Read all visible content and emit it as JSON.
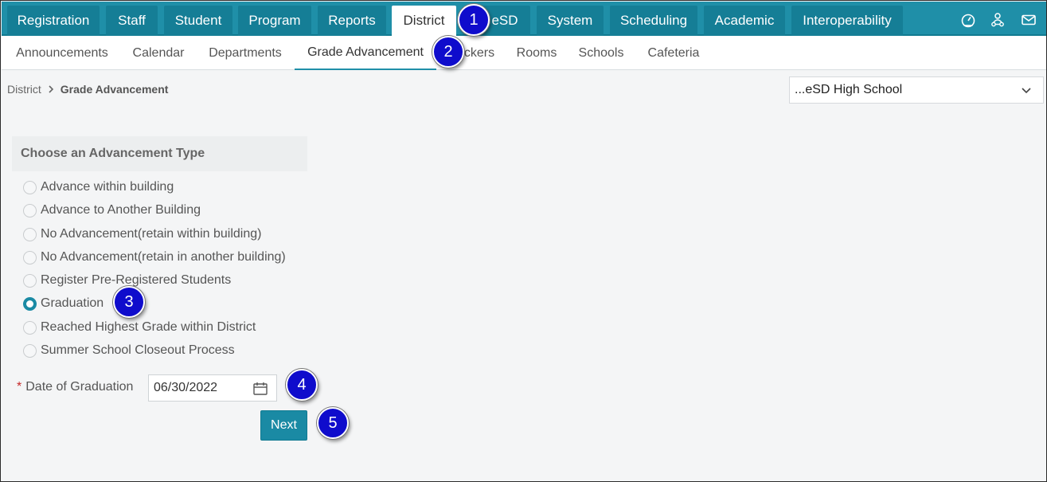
{
  "top_nav": {
    "tabs": [
      {
        "label": "Registration"
      },
      {
        "label": "Staff"
      },
      {
        "label": "Student"
      },
      {
        "label": "Program"
      },
      {
        "label": "Reports"
      },
      {
        "label": "District"
      },
      {
        "label": "eSD"
      },
      {
        "label": "System"
      },
      {
        "label": "Scheduling"
      },
      {
        "label": "Academic"
      },
      {
        "label": "Interoperability"
      }
    ],
    "active_tab": "District",
    "icons": [
      "dashboard-icon",
      "users-network-icon",
      "mail-icon"
    ]
  },
  "sub_nav": {
    "tabs": [
      {
        "label": "Announcements"
      },
      {
        "label": "Calendar"
      },
      {
        "label": "Departments"
      },
      {
        "label": "Grade Advancement"
      },
      {
        "label": "ckers"
      },
      {
        "label": "Rooms"
      },
      {
        "label": "Schools"
      },
      {
        "label": "Cafeteria"
      }
    ],
    "active_tab": "Grade Advancement"
  },
  "breadcrumb": {
    "root": "District",
    "current": "Grade Advancement"
  },
  "school_select": {
    "value": "...eSD High School"
  },
  "advancement": {
    "header": "Choose an Advancement Type",
    "options": [
      {
        "label": "Advance within building",
        "checked": false
      },
      {
        "label": "Advance to Another Building",
        "checked": false
      },
      {
        "label": "No Advancement(retain within building)",
        "checked": false
      },
      {
        "label": "No Advancement(retain in another building)",
        "checked": false
      },
      {
        "label": "Register Pre-Registered Students",
        "checked": false
      },
      {
        "label": "Graduation",
        "checked": true
      },
      {
        "label": "Reached Highest Grade within District",
        "checked": false
      },
      {
        "label": "Summer School Closeout Process",
        "checked": false
      }
    ]
  },
  "graduation_date": {
    "required_mark": "*",
    "label": "Date of Graduation",
    "value": "06/30/2022"
  },
  "next_button": {
    "label": "Next"
  },
  "step_badges": [
    "1",
    "2",
    "3",
    "4",
    "5"
  ],
  "colors": {
    "nav_background": "#1f8fa8",
    "tab_background": "#157e96",
    "accent": "#1a8aa4",
    "badge": "#0f0ccc",
    "required": "#c62828"
  }
}
